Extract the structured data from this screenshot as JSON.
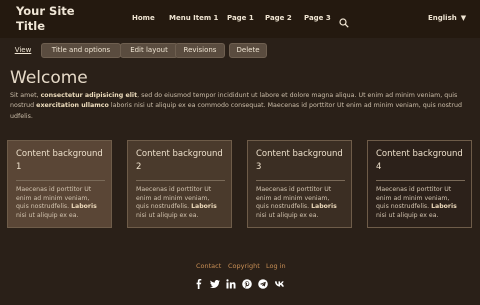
{
  "header": {
    "site_title": "Your Site Title",
    "nav": [
      "Home",
      "Menu Item 1",
      "Page 1",
      "Page 2",
      "Page 3"
    ],
    "language": "English"
  },
  "tabs": [
    "View",
    "Title and options",
    "Edit layout",
    "Revisions",
    "Delete"
  ],
  "main": {
    "heading": "Welcome",
    "intro_parts": [
      "Sit amet, ",
      "consectetur adipisicing elit",
      ", sed do eiusmod tempor incididunt ut labore et dolore magna aliqua. Ut enim ad minim veniam, quis nostrud ",
      "exercitation ullamco",
      " laboris nisi ut aliquip ex ea commodo consequat. Maecenas id porttitor Ut enim ad minim veniam, quis nostrud udfelis."
    ]
  },
  "cards": [
    {
      "title": "Content background 1",
      "text": "Maecenas id porttitor Ut enim ad minim veniam, quis nostrudfelis.",
      "bold": "Laboris",
      "text2": "nisi ut aliquip ex ea.",
      "bg": "#5a4636"
    },
    {
      "title": "Content background 2",
      "text": "Maecenas id porttitor Ut enim ad minim veniam, quis nostrudfelis.",
      "bold": "Laboris",
      "text2": "nisi ut aliquip ex ea.",
      "bg": "#4a3a2c"
    },
    {
      "title": "Content background 3",
      "text": "Maecenas id porttitor Ut enim ad minim veniam, quis nostrudfelis.",
      "bold": "Laboris",
      "text2": "nisi ut aliquip ex ea.",
      "bg": "#3b2e23"
    },
    {
      "title": "Content background 4",
      "text": "Maecenas id porttitor Ut enim ad minim veniam, quis nostrudfelis.",
      "bold": "Laboris",
      "text2": "nisi ut aliquip ex ea.",
      "bg": "#2c211a"
    }
  ],
  "footer": {
    "links": [
      "Contact",
      "Copyright",
      "Log in"
    ],
    "social": [
      "facebook-icon",
      "twitter-icon",
      "linkedin-icon",
      "pinterest-icon",
      "telegram-icon",
      "vk-icon"
    ]
  },
  "colors": {
    "accent_link": "#c98f55",
    "background": "#2a2018",
    "header_bg": "#24190f"
  }
}
